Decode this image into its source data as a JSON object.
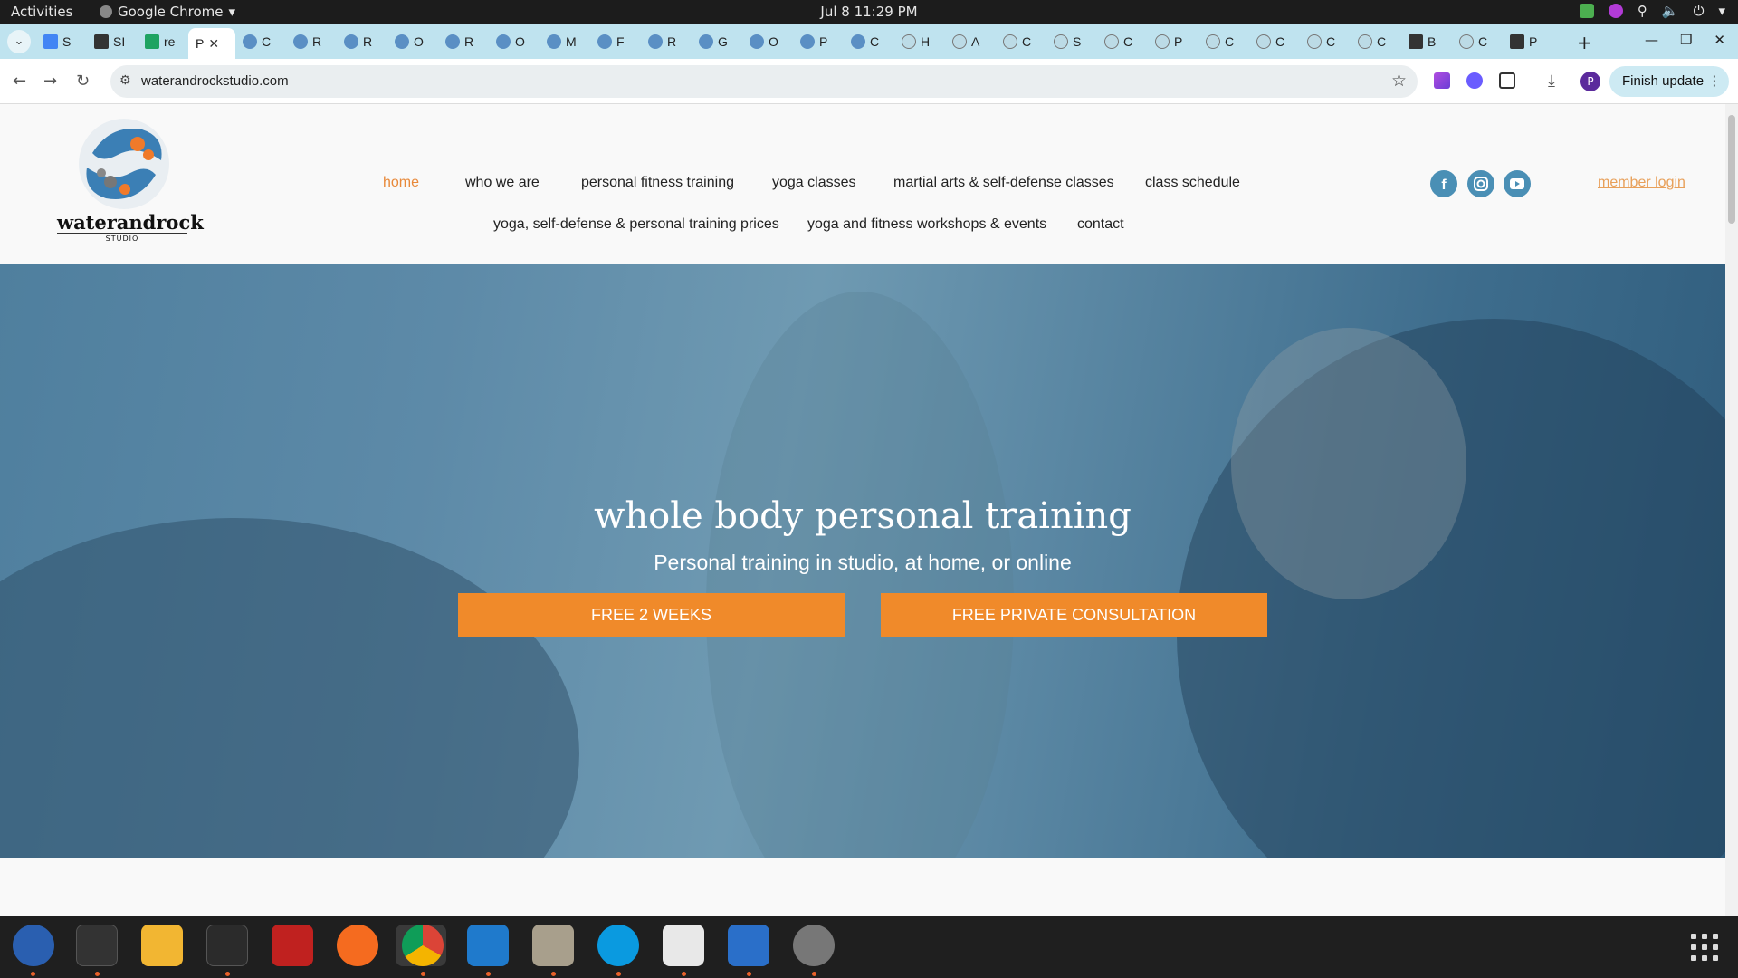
{
  "system": {
    "activities": "Activities",
    "app_name": "Google Chrome",
    "clock": "Jul 8  11:29 PM"
  },
  "browser": {
    "tabs": [
      {
        "label": "S",
        "icon": "docs-icon"
      },
      {
        "label": "SI",
        "icon": "wp-icon"
      },
      {
        "label": "re",
        "icon": "sheets-icon"
      },
      {
        "label": "P",
        "icon": "page-icon",
        "active": true
      },
      {
        "label": "C",
        "icon": "site-icon"
      },
      {
        "label": "R",
        "icon": "site-icon"
      },
      {
        "label": "R",
        "icon": "site-icon"
      },
      {
        "label": "O",
        "icon": "site-icon"
      },
      {
        "label": "R",
        "icon": "site-icon"
      },
      {
        "label": "O",
        "icon": "site-icon"
      },
      {
        "label": "M",
        "icon": "site-icon"
      },
      {
        "label": "F",
        "icon": "site-icon"
      },
      {
        "label": "R",
        "icon": "site-icon"
      },
      {
        "label": "G",
        "icon": "site-icon"
      },
      {
        "label": "O",
        "icon": "site-icon"
      },
      {
        "label": "P",
        "icon": "site-icon"
      },
      {
        "label": "C",
        "icon": "site-icon"
      },
      {
        "label": "H",
        "icon": "a-icon"
      },
      {
        "label": "A",
        "icon": "a-icon"
      },
      {
        "label": "C",
        "icon": "a-icon"
      },
      {
        "label": "S",
        "icon": "a-icon"
      },
      {
        "label": "C",
        "icon": "a-icon"
      },
      {
        "label": "P",
        "icon": "a-icon"
      },
      {
        "label": "C",
        "icon": "a-icon"
      },
      {
        "label": "C",
        "icon": "a-icon"
      },
      {
        "label": "C",
        "icon": "a-icon"
      },
      {
        "label": "C",
        "icon": "a-icon"
      },
      {
        "label": "B",
        "icon": "globe-icon"
      },
      {
        "label": "C",
        "icon": "a-icon"
      },
      {
        "label": "P",
        "icon": "fs-icon"
      }
    ],
    "url": "waterandrockstudio.com",
    "finish_update": "Finish update",
    "profile_initial": "P"
  },
  "site": {
    "logo_word": "waterandrock",
    "logo_sub": "STUDIO",
    "nav": [
      {
        "label": "home",
        "active": true
      },
      {
        "label": "who we are"
      },
      {
        "label": "personal fitness training"
      },
      {
        "label": "yoga classes"
      },
      {
        "label": "martial arts & self-defense classes"
      },
      {
        "label": "class schedule"
      },
      {
        "label": "yoga, self-defense & personal training prices"
      },
      {
        "label": "yoga and fitness workshops & events"
      },
      {
        "label": "contact"
      }
    ],
    "member_login": "member login",
    "hero": {
      "title": "whole body personal training",
      "subtitle": "Personal training in studio, at home, or online",
      "cta_primary": "FREE 2 WEEKS",
      "cta_secondary": "FREE PRIVATE CONSULTATION"
    }
  },
  "colors": {
    "accent": "#f08a2a",
    "nav_active": "#e8893a",
    "social": "#4a8fb5",
    "chrome_frame": "#bfe3ef"
  }
}
